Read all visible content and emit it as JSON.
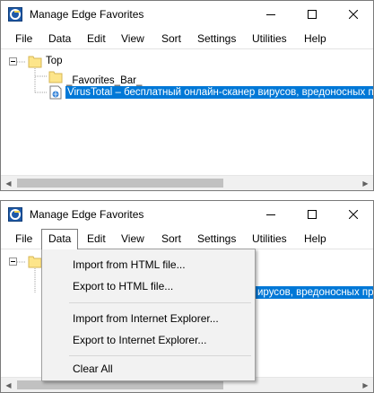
{
  "window": {
    "title": "Manage Edge Favorites",
    "controls": {
      "minimize": "minimize-icon",
      "maximize": "maximize-icon",
      "close": "close-icon"
    }
  },
  "menu": [
    "File",
    "Data",
    "Edit",
    "View",
    "Sort",
    "Settings",
    "Utilities",
    "Help"
  ],
  "tree": {
    "root": "Top",
    "children": [
      {
        "label": "_Favorites_Bar_",
        "icon": "folder-icon"
      },
      {
        "label": "VirusTotal – бесплатный онлайн-сканер вирусов, вредоносных програ",
        "icon": "url-icon",
        "selected": true
      }
    ]
  },
  "tree_fragment_visible": "ирусов, вредоносных прогр",
  "data_menu": {
    "items": [
      "Import from HTML file...",
      "Export to HTML file...",
      "Import from Internet Explorer...",
      "Export to Internet Explorer...",
      "Clear All"
    ]
  },
  "colors": {
    "selection": "#0078d7",
    "menu_bg": "#f2f2f2",
    "folder": "#fde58a"
  }
}
